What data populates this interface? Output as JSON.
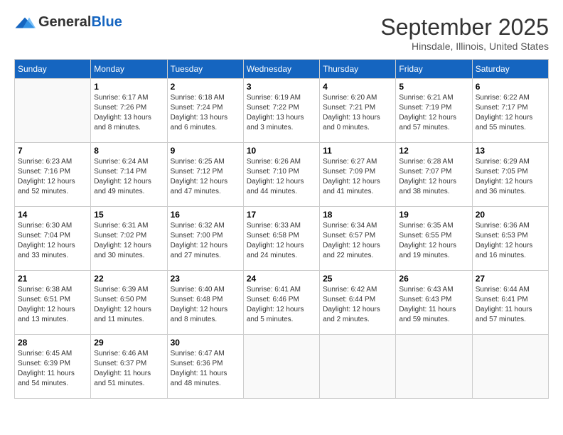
{
  "header": {
    "logo_general": "General",
    "logo_blue": "Blue",
    "month": "September 2025",
    "location": "Hinsdale, Illinois, United States"
  },
  "weekdays": [
    "Sunday",
    "Monday",
    "Tuesday",
    "Wednesday",
    "Thursday",
    "Friday",
    "Saturday"
  ],
  "weeks": [
    [
      {
        "day": "",
        "info": ""
      },
      {
        "day": "1",
        "info": "Sunrise: 6:17 AM\nSunset: 7:26 PM\nDaylight: 13 hours\nand 8 minutes."
      },
      {
        "day": "2",
        "info": "Sunrise: 6:18 AM\nSunset: 7:24 PM\nDaylight: 13 hours\nand 6 minutes."
      },
      {
        "day": "3",
        "info": "Sunrise: 6:19 AM\nSunset: 7:22 PM\nDaylight: 13 hours\nand 3 minutes."
      },
      {
        "day": "4",
        "info": "Sunrise: 6:20 AM\nSunset: 7:21 PM\nDaylight: 13 hours\nand 0 minutes."
      },
      {
        "day": "5",
        "info": "Sunrise: 6:21 AM\nSunset: 7:19 PM\nDaylight: 12 hours\nand 57 minutes."
      },
      {
        "day": "6",
        "info": "Sunrise: 6:22 AM\nSunset: 7:17 PM\nDaylight: 12 hours\nand 55 minutes."
      }
    ],
    [
      {
        "day": "7",
        "info": "Sunrise: 6:23 AM\nSunset: 7:16 PM\nDaylight: 12 hours\nand 52 minutes."
      },
      {
        "day": "8",
        "info": "Sunrise: 6:24 AM\nSunset: 7:14 PM\nDaylight: 12 hours\nand 49 minutes."
      },
      {
        "day": "9",
        "info": "Sunrise: 6:25 AM\nSunset: 7:12 PM\nDaylight: 12 hours\nand 47 minutes."
      },
      {
        "day": "10",
        "info": "Sunrise: 6:26 AM\nSunset: 7:10 PM\nDaylight: 12 hours\nand 44 minutes."
      },
      {
        "day": "11",
        "info": "Sunrise: 6:27 AM\nSunset: 7:09 PM\nDaylight: 12 hours\nand 41 minutes."
      },
      {
        "day": "12",
        "info": "Sunrise: 6:28 AM\nSunset: 7:07 PM\nDaylight: 12 hours\nand 38 minutes."
      },
      {
        "day": "13",
        "info": "Sunrise: 6:29 AM\nSunset: 7:05 PM\nDaylight: 12 hours\nand 36 minutes."
      }
    ],
    [
      {
        "day": "14",
        "info": "Sunrise: 6:30 AM\nSunset: 7:04 PM\nDaylight: 12 hours\nand 33 minutes."
      },
      {
        "day": "15",
        "info": "Sunrise: 6:31 AM\nSunset: 7:02 PM\nDaylight: 12 hours\nand 30 minutes."
      },
      {
        "day": "16",
        "info": "Sunrise: 6:32 AM\nSunset: 7:00 PM\nDaylight: 12 hours\nand 27 minutes."
      },
      {
        "day": "17",
        "info": "Sunrise: 6:33 AM\nSunset: 6:58 PM\nDaylight: 12 hours\nand 24 minutes."
      },
      {
        "day": "18",
        "info": "Sunrise: 6:34 AM\nSunset: 6:57 PM\nDaylight: 12 hours\nand 22 minutes."
      },
      {
        "day": "19",
        "info": "Sunrise: 6:35 AM\nSunset: 6:55 PM\nDaylight: 12 hours\nand 19 minutes."
      },
      {
        "day": "20",
        "info": "Sunrise: 6:36 AM\nSunset: 6:53 PM\nDaylight: 12 hours\nand 16 minutes."
      }
    ],
    [
      {
        "day": "21",
        "info": "Sunrise: 6:38 AM\nSunset: 6:51 PM\nDaylight: 12 hours\nand 13 minutes."
      },
      {
        "day": "22",
        "info": "Sunrise: 6:39 AM\nSunset: 6:50 PM\nDaylight: 12 hours\nand 11 minutes."
      },
      {
        "day": "23",
        "info": "Sunrise: 6:40 AM\nSunset: 6:48 PM\nDaylight: 12 hours\nand 8 minutes."
      },
      {
        "day": "24",
        "info": "Sunrise: 6:41 AM\nSunset: 6:46 PM\nDaylight: 12 hours\nand 5 minutes."
      },
      {
        "day": "25",
        "info": "Sunrise: 6:42 AM\nSunset: 6:44 PM\nDaylight: 12 hours\nand 2 minutes."
      },
      {
        "day": "26",
        "info": "Sunrise: 6:43 AM\nSunset: 6:43 PM\nDaylight: 11 hours\nand 59 minutes."
      },
      {
        "day": "27",
        "info": "Sunrise: 6:44 AM\nSunset: 6:41 PM\nDaylight: 11 hours\nand 57 minutes."
      }
    ],
    [
      {
        "day": "28",
        "info": "Sunrise: 6:45 AM\nSunset: 6:39 PM\nDaylight: 11 hours\nand 54 minutes."
      },
      {
        "day": "29",
        "info": "Sunrise: 6:46 AM\nSunset: 6:37 PM\nDaylight: 11 hours\nand 51 minutes."
      },
      {
        "day": "30",
        "info": "Sunrise: 6:47 AM\nSunset: 6:36 PM\nDaylight: 11 hours\nand 48 minutes."
      },
      {
        "day": "",
        "info": ""
      },
      {
        "day": "",
        "info": ""
      },
      {
        "day": "",
        "info": ""
      },
      {
        "day": "",
        "info": ""
      }
    ]
  ]
}
